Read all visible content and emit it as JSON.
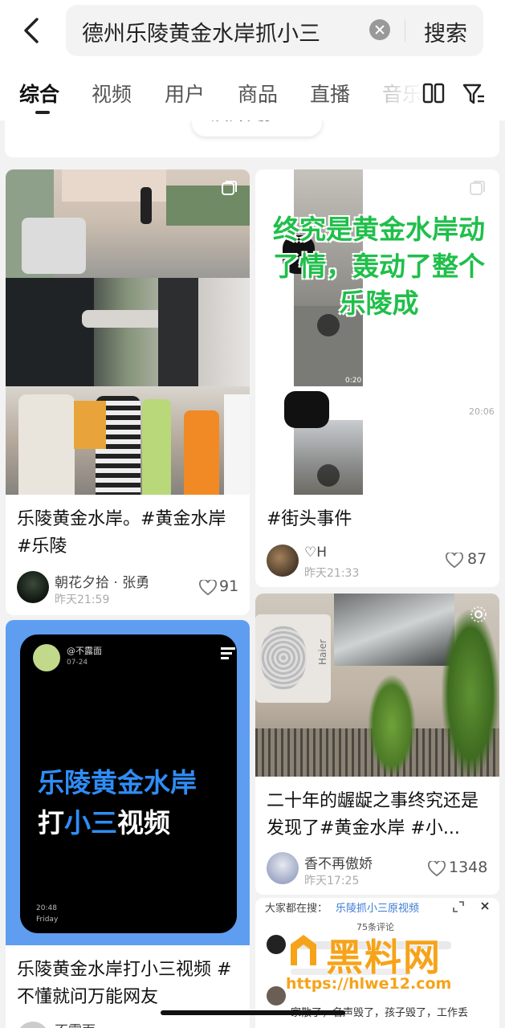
{
  "header": {
    "search_query": "德州乐陵黄金水岸抓小三",
    "search_button": "搜索",
    "icons": [
      "back-arrow-icon",
      "clear-icon",
      "layout-icon",
      "filter-icon"
    ]
  },
  "tabs": [
    {
      "label": "综合",
      "active": true
    },
    {
      "label": "视频",
      "active": false
    },
    {
      "label": "用户",
      "active": false
    },
    {
      "label": "商品",
      "active": false
    },
    {
      "label": "直播",
      "active": false
    },
    {
      "label": "音乐",
      "active": false
    }
  ],
  "expand": {
    "label": "展开更多"
  },
  "cards": [
    {
      "title": "乐陵黄金水岸。#黄金水岸 #乐陵",
      "author": "朝花夕拾 · 张勇",
      "time": "昨天21:59",
      "likes": "91"
    },
    {
      "overlay_text": "终究是黄金水岸动了情，轰动了整个乐陵成",
      "thumb_duration": "0:20",
      "thumb_time": "20:06",
      "title": "#街头事件",
      "author": "♡H",
      "time": "昨天21:33",
      "likes": "87"
    },
    {
      "phone_user": "@不露面",
      "phone_date": "07-24",
      "phone_title": "乐陵黄金水岸",
      "phone_subtitle_prefix": "打",
      "phone_subtitle_highlight": "小三",
      "phone_subtitle_suffix": "视频",
      "phone_time": "20:48",
      "phone_day": "Friday",
      "title": "乐陵黄金水岸打小三视频 #不懂就问万能网友",
      "author": "不露面"
    },
    {
      "image_label": "Haier",
      "title": "二十年的龌龊之事终究还是发现了#黄金水岸 #小...",
      "author": "香不再傲娇",
      "time": "昨天17:25",
      "likes": "1348"
    },
    {
      "search_label": "大家都在搜：",
      "search_link": "乐陵抓小三原视频",
      "comments_label": "75条评论",
      "comment_tail": "家散了，名声毁了，孩子毁了，工作丢"
    }
  ],
  "watermark": {
    "brand": "黑料网",
    "url": "https://hlwe12.com"
  },
  "colors": {
    "accent_green": "#1fbf4a",
    "accent_blue": "#2f8df6",
    "watermark_orange": "#f6a31a"
  }
}
